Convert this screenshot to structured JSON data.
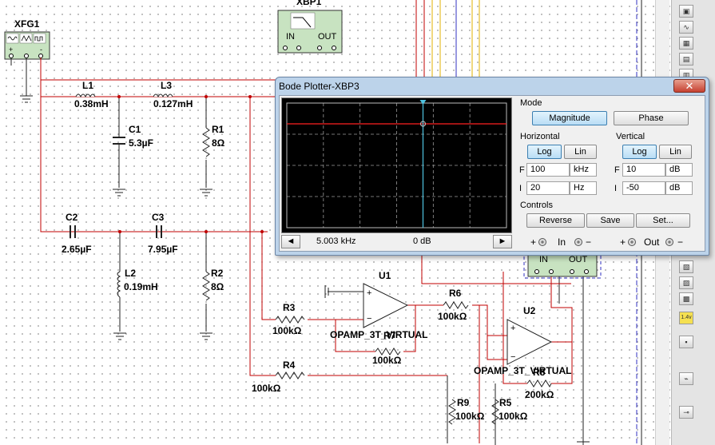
{
  "instruments": {
    "xfg_label": "XFG1",
    "xbp_top_label": "XBP1",
    "xbp_in": "IN",
    "xbp_out": "OUT",
    "xbp3_in": "IN",
    "xbp3_out": "OUT",
    "plus": "+",
    "minus": "-"
  },
  "components": {
    "L1": {
      "name": "L1",
      "value": "0.38mH"
    },
    "L3": {
      "name": "L3",
      "value": "0.127mH"
    },
    "C1": {
      "name": "C1",
      "value": "5.3µF"
    },
    "R1": {
      "name": "R1",
      "value": "8Ω"
    },
    "C2": {
      "name": "C2",
      "value": "2.65µF"
    },
    "C3": {
      "name": "C3",
      "value": "7.95µF"
    },
    "L2": {
      "name": "L2",
      "value": "0.19mH"
    },
    "R2": {
      "name": "R2",
      "value": "8Ω"
    },
    "U1": {
      "name": "U1",
      "value": "OPAMP_3T_VIRTUAL"
    },
    "U2": {
      "name": "U2",
      "value": "OPAMP_3T_VIRTUAL"
    },
    "R3": {
      "name": "R3",
      "value": "100kΩ"
    },
    "R4": {
      "name": "R4",
      "value": "100kΩ"
    },
    "R6": {
      "name": "R6",
      "value": "100kΩ"
    },
    "R7": {
      "name": "R7",
      "value": "100kΩ"
    },
    "R8": {
      "name": "R8",
      "value": "200kΩ"
    },
    "R9": {
      "name": "R9",
      "value": "100kΩ"
    },
    "R5": {
      "name": "R5",
      "value": "100kΩ"
    }
  },
  "bode": {
    "title": "Bode Plotter-XBP3",
    "close_glyph": "✕",
    "mode_label": "Mode",
    "magnitude_btn": "Magnitude",
    "phase_btn": "Phase",
    "active_mode": "Magnitude",
    "horizontal_label": "Horizontal",
    "vertical_label": "Vertical",
    "h_log": "Log",
    "h_lin": "Lin",
    "v_log": "Log",
    "v_lin": "Lin",
    "h_scale": "Log",
    "v_scale": "Log",
    "f_label": "F",
    "i_label": "I",
    "h_final_value": "100",
    "h_final_unit": "kHz",
    "h_initial_value": "20",
    "h_initial_unit": "Hz",
    "v_final_value": "10",
    "v_final_unit": "dB",
    "v_initial_value": "-50",
    "v_initial_unit": "dB",
    "controls_label": "Controls",
    "reverse_btn": "Reverse",
    "save_btn": "Save",
    "set_btn": "Set...",
    "readout_freq": "5.003 kHz",
    "readout_gain": "0 dB",
    "left_arrow": "◄",
    "right_arrow": "►",
    "in_label": "In",
    "out_label": "Out",
    "plus": "+",
    "minus": "−",
    "cursor_fraction": 0.62,
    "trace_db": 0,
    "trace_color": "#ff2020",
    "cursor_color": "#4ec3e0"
  },
  "toolbar": {
    "version_badge": "1.4v"
  },
  "colors": {
    "wire_red": "#c00000",
    "wire_dark": "#222222",
    "bus_yellow": "#e0b000",
    "bus_blue": "#3030c0"
  }
}
